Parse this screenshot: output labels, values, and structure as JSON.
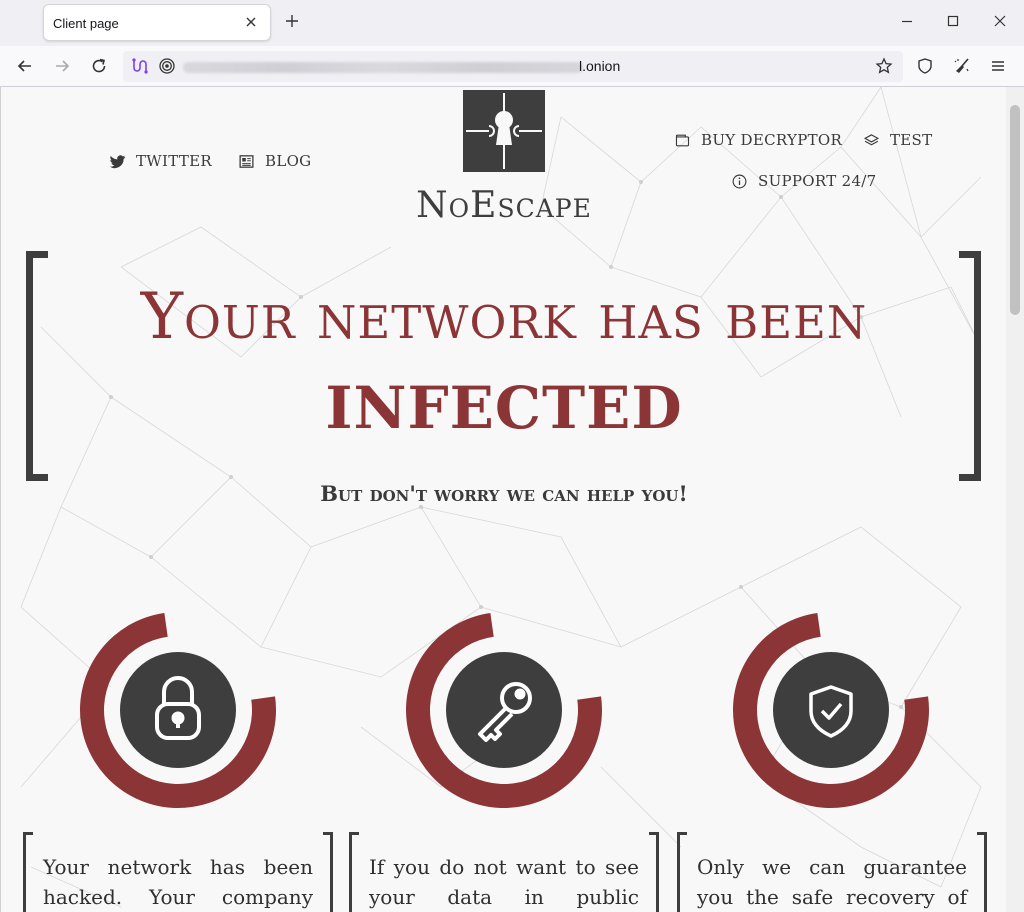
{
  "browser": {
    "tab_title": "Client page",
    "url_suffix": "l.onion"
  },
  "site": {
    "brand": "NoEscape",
    "nav_left": [
      {
        "label": "TWITTER",
        "icon": "twitter-icon"
      },
      {
        "label": "BLOG",
        "icon": "newspaper-icon"
      }
    ],
    "nav_right": [
      {
        "label": "BUY DECRYPTOR",
        "icon": "wallet-icon"
      },
      {
        "label": "TEST",
        "icon": "layers-icon"
      },
      {
        "label": "SUPPORT 24/7",
        "icon": "info-icon"
      }
    ],
    "headline": "Your network has been",
    "headline_strong": "INFECTED",
    "subline": "But don't worry we can help you!",
    "features": [
      {
        "icon": "padlock-icon"
      },
      {
        "icon": "key-icon"
      },
      {
        "icon": "shield-check-icon"
      }
    ],
    "cards": [
      "Your network has been hacked. Your company",
      "If you do not want to see your data in public",
      "Only we can guarantee you the safe recovery of"
    ]
  },
  "colors": {
    "accent": "#8c3537",
    "dark": "#3e3e3e",
    "page_bg": "#f8f8f8"
  }
}
